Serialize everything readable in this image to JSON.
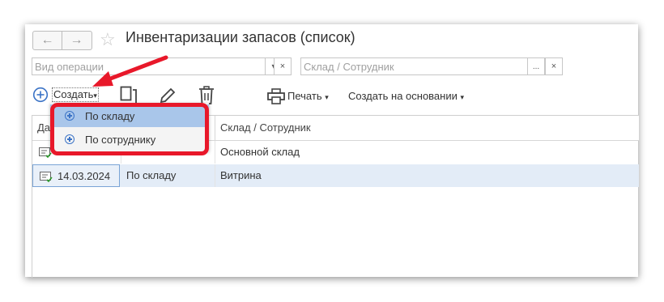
{
  "window": {
    "title": "Инвентаризации запасов (список)",
    "nav_back_icon": "←",
    "nav_forward_icon": "→",
    "favorite_icon": "☆"
  },
  "filters": {
    "operation_placeholder": "Вид операции",
    "warehouse_placeholder": "Склад / Сотрудник",
    "dropdown_icon": "▾",
    "clear_icon": "×",
    "select_icon": "..."
  },
  "toolbar": {
    "create_label": "Создать",
    "print_label": "Печать",
    "create_based_on_label": "Создать на основании",
    "dropdown_arrow": "▾"
  },
  "create_menu": {
    "items": [
      {
        "label": "По складу",
        "highlighted": true
      },
      {
        "label": "По сотруднику",
        "highlighted": false
      }
    ]
  },
  "table": {
    "columns": [
      "Дата",
      "",
      "Склад / Сотрудник"
    ],
    "rows": [
      {
        "date": "",
        "type": "",
        "warehouse": "Основной склад"
      },
      {
        "date": "14.03.2024",
        "type": "По складу",
        "warehouse": "Витрина",
        "selected": true
      }
    ]
  },
  "colors": {
    "accent": "#3b73c6",
    "highlight": "#e8182a",
    "menu_highlight": "#a9c6ea"
  }
}
